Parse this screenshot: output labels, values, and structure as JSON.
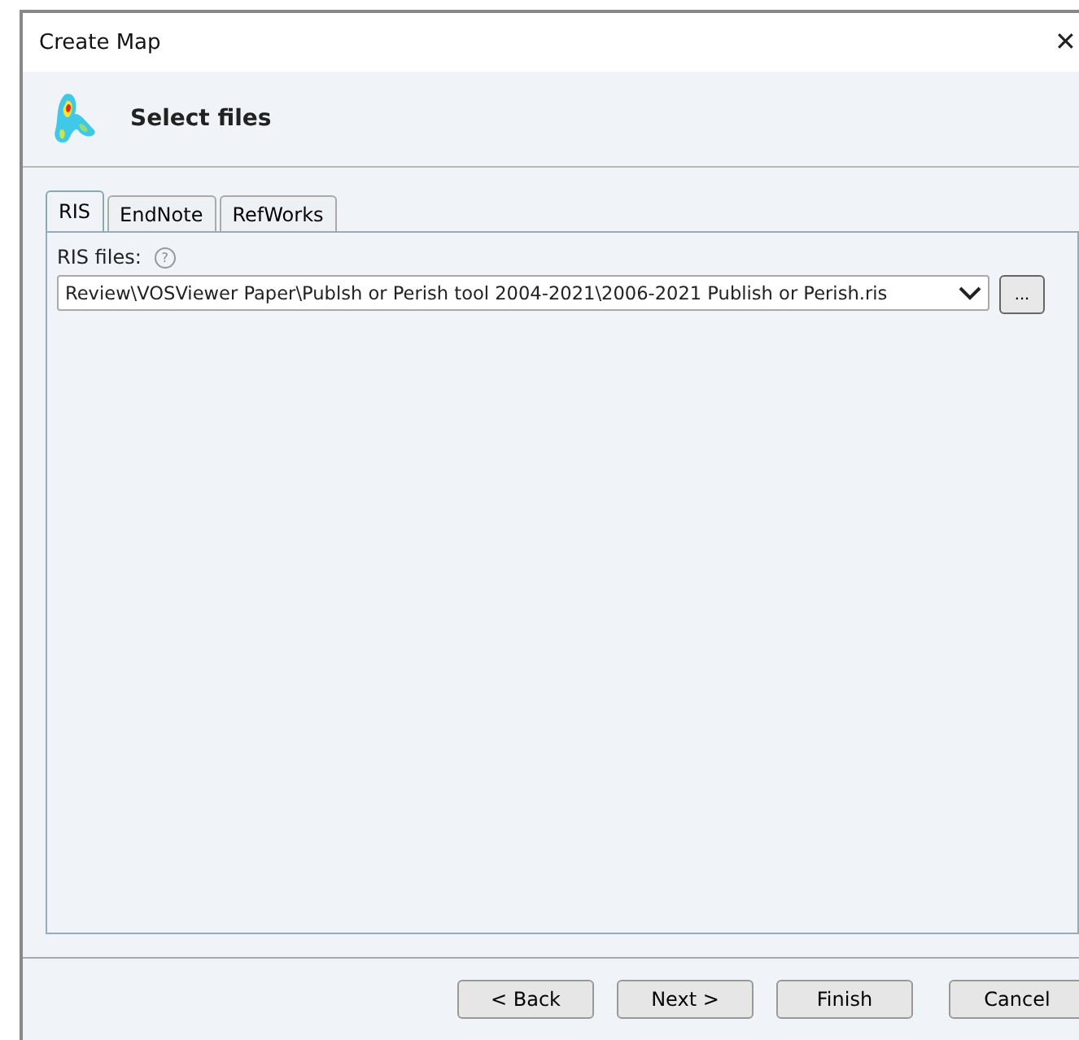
{
  "window": {
    "title": "Create Map",
    "close": "✕"
  },
  "header": {
    "title": "Select files"
  },
  "tabs": [
    {
      "label": "RIS",
      "selected": true
    },
    {
      "label": "EndNote",
      "selected": false
    },
    {
      "label": "RefWorks",
      "selected": false
    }
  ],
  "field": {
    "label": "RIS files:",
    "help": "?",
    "value": "Review\\VOSViewer Paper\\Publsh or Perish tool 2004-2021\\2006-2021 Publish or Perish.ris",
    "browse": "..."
  },
  "buttons": [
    "< Back",
    "Next >",
    "Finish",
    "Cancel"
  ]
}
